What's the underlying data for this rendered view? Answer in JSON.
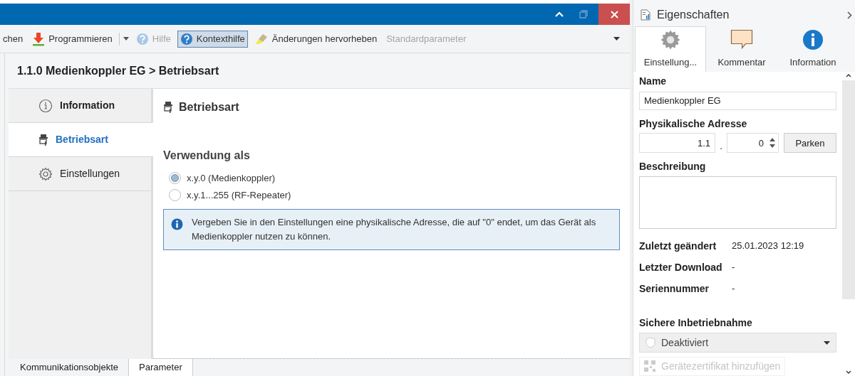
{
  "toolbar": {
    "items": [
      {
        "kind": "plain",
        "label": "chen",
        "disabled": false,
        "selected": false
      },
      {
        "kind": "download",
        "label": "Programmieren",
        "disabled": false,
        "selected": false,
        "has_dropdown": true
      },
      {
        "kind": "help",
        "label": "Hilfe",
        "disabled": true,
        "selected": false
      },
      {
        "kind": "help",
        "label": "Kontexthilfe",
        "disabled": false,
        "selected": true
      },
      {
        "kind": "highlight",
        "label": "Änderungen hervorheben",
        "disabled": false,
        "selected": false
      },
      {
        "kind": "plain",
        "label": "Standardparameter",
        "disabled": true,
        "selected": false
      }
    ]
  },
  "breadcrumb": "1.1.0 Medienkoppler EG > Betriebsart",
  "nav": [
    {
      "kind": "info",
      "label": "Information",
      "selected": false
    },
    {
      "kind": "device",
      "label": "Betriebsart",
      "selected": true
    },
    {
      "kind": "gear",
      "label": "Einstellungen",
      "selected": false
    }
  ],
  "section": {
    "title": "Betriebsart",
    "group_label": "Verwendung als",
    "options": [
      {
        "label": "x.y.0 (Medienkoppler)",
        "selected": true
      },
      {
        "label": "x.y.1...255 (RF-Repeater)",
        "selected": false
      }
    ],
    "info_text": "Vergeben Sie in den Einstellungen eine physikalische Adresse, die auf \"0\" endet, um das Gerät als Medienkoppler nutzen zu können."
  },
  "bottom_tabs": [
    {
      "label": "Kommunikationsobjekte",
      "selected": false
    },
    {
      "label": "Parameter",
      "selected": true
    }
  ],
  "properties": {
    "title": "Eigenschaften",
    "tabs": [
      {
        "kind": "gear",
        "label": "Einstellung...",
        "selected": true
      },
      {
        "kind": "comment",
        "label": "Kommentar",
        "selected": false
      },
      {
        "kind": "info",
        "label": "Information",
        "selected": false
      }
    ],
    "name_label": "Name",
    "name_value": "Medienkoppler EG",
    "address_label": "Physikalische Adresse",
    "address_prefix": "1.1",
    "separator": ".",
    "address_value": "0",
    "park_button": "Parken",
    "description_label": "Beschreibung",
    "details": [
      {
        "label": "Zuletzt geändert",
        "value": "25.01.2023 12:19"
      },
      {
        "label": "Letzter Download",
        "value": "-"
      },
      {
        "label": "Seriennummer",
        "value": "-"
      }
    ],
    "secure_label": "Sichere Inbetriebnahme",
    "secure_value": "Deaktiviert",
    "certificate_button": {
      "label": "Gerätezertifikat hinzufügen",
      "disabled": true
    }
  }
}
